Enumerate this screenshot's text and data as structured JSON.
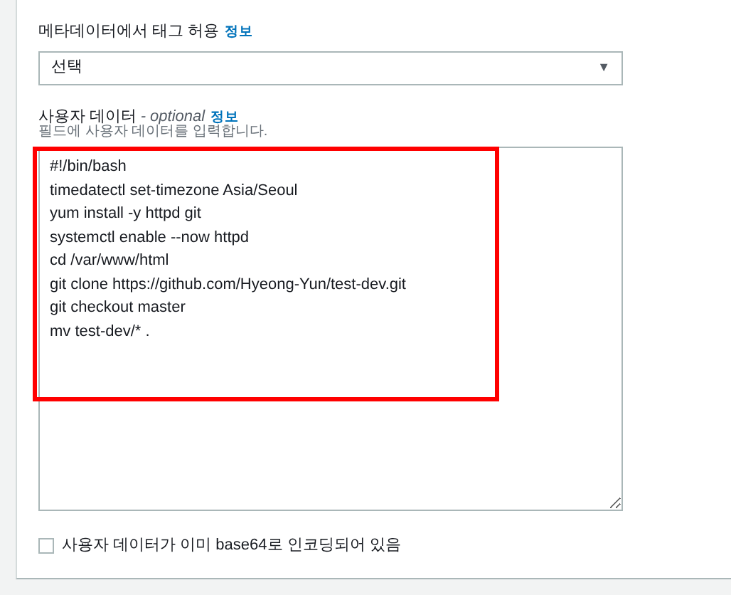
{
  "metadata_tags": {
    "label": "메타데이터에서 태그 허용",
    "info_link": "정보",
    "select": {
      "value": "선택",
      "caret": "▼"
    }
  },
  "user_data": {
    "label": "사용자 데이터",
    "optional": "- optional",
    "info_link": "정보",
    "hint": "필드에 사용자 데이터를 입력합니다.",
    "lines": [
      "#!/bin/bash",
      "timedatectl set-timezone Asia/Seoul",
      "yum install -y httpd git",
      "systemctl enable --now httpd",
      "cd /var/www/html",
      "git clone https://github.com/Hyeong-Yun/test-dev.git",
      "git checkout master",
      "mv test-dev/* ."
    ],
    "highlighted": true
  },
  "base64_checkbox": {
    "label": "사용자 데이터가 이미 base64로 인코딩되어 있음",
    "checked": false
  }
}
